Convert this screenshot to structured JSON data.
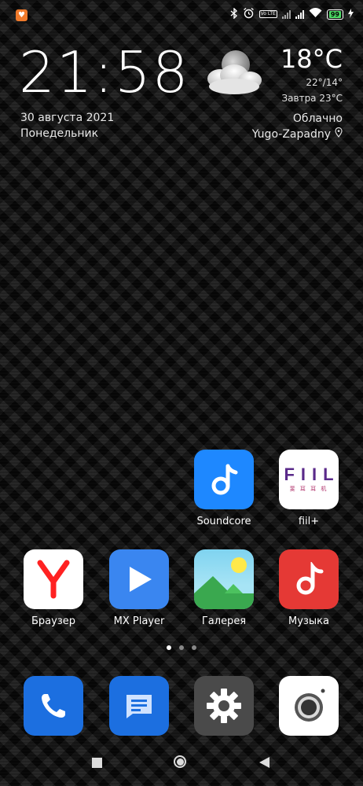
{
  "status_bar": {
    "battery_level": "99",
    "icons": [
      "notification-app-icon",
      "bluetooth-icon",
      "alarm-icon",
      "volte-icon",
      "signal-icon",
      "signal-icon",
      "wifi-icon",
      "battery-icon",
      "charging-icon"
    ],
    "volte_text": "Vo LTE"
  },
  "clock": {
    "time": "21:58",
    "date": "30 августа 2021",
    "weekday": "Понедельник"
  },
  "weather": {
    "temperature": "18°C",
    "range": "22°/14°",
    "tomorrow": "Завтра  23°C",
    "condition": "Облачно",
    "location": "Yugo-Zapadny"
  },
  "apps": {
    "soundcore": "Soundcore",
    "fiil": "fiil+",
    "browser": "Браузер",
    "mxplayer": "MX Player",
    "gallery": "Галерея",
    "music": "Музыка"
  },
  "fiil_logo": {
    "text": "FIIL",
    "sub": "斐 耳 耳 机"
  },
  "page_indicator": {
    "pages": 3,
    "current": 1
  },
  "dock": [
    "phone",
    "messages",
    "settings",
    "camera"
  ],
  "colors": {
    "soundcore": "#1e88ff",
    "mxplayer": "#3a86f0",
    "music": "#e53935",
    "phone": "#1c6fe0",
    "messages": "#1c6fe0",
    "settings": "#4a4a4a",
    "yandex_red": "#f22"
  }
}
